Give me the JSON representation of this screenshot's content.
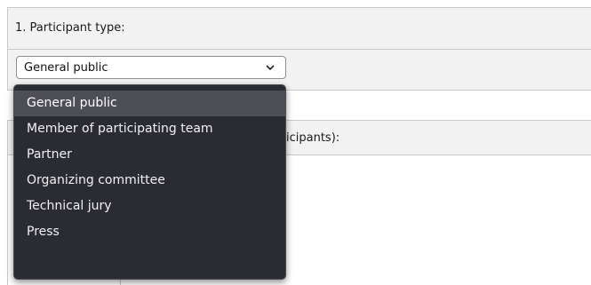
{
  "question1": {
    "label": "1. Participant type:",
    "selected_value": "General public"
  },
  "question2": {
    "label_visible": "icipants):"
  },
  "dropdown": {
    "options": [
      "General public",
      "Member of participating team",
      "Partner",
      "Organizing committee",
      "Technical jury",
      "Press"
    ],
    "selected_index": 0
  }
}
